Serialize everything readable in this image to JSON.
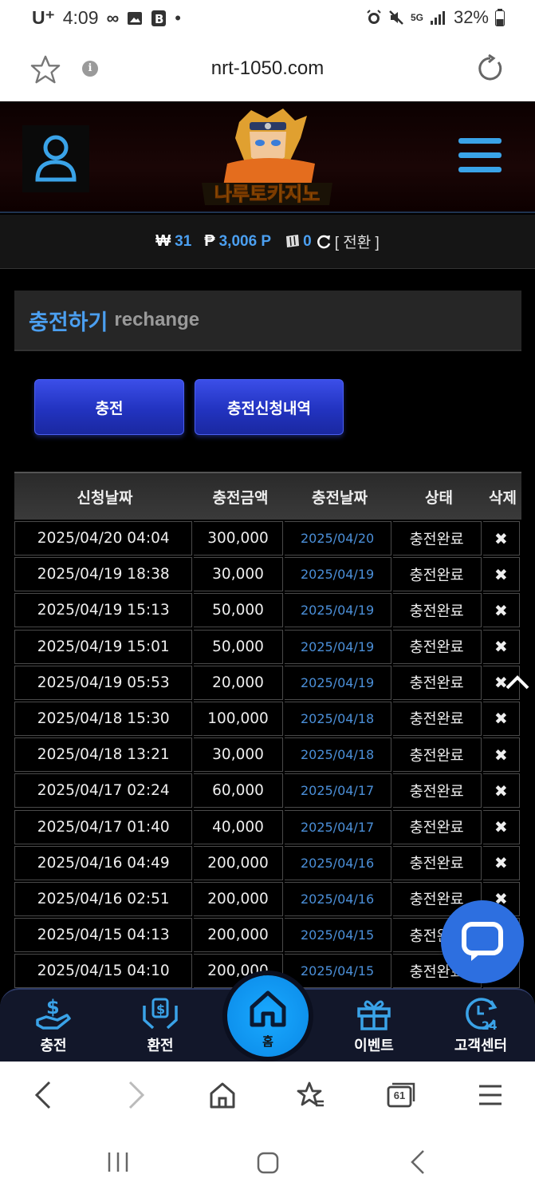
{
  "status_bar": {
    "carrier": "U⁺",
    "time": "4:09",
    "battery": "32%",
    "network": "5G"
  },
  "browser": {
    "url": "nrt-1050.com",
    "tabs_count": "61"
  },
  "site": {
    "logo_text": "나루토카지노"
  },
  "balance": {
    "won_symbol": "₩",
    "won_value": "31",
    "point_symbol": "₱",
    "point_value": "3,006 P",
    "chip_value": "0",
    "convert_label": "[ 전환 ]"
  },
  "page_title": {
    "ko": "충전하기",
    "en": "rechange"
  },
  "tabs": {
    "charge": "충전",
    "history": "충전신청내역"
  },
  "table": {
    "headers": [
      "신청날짜",
      "충전금액",
      "충전날짜",
      "상태",
      "삭제"
    ],
    "rows": [
      {
        "req": "2025/04/20 04:04",
        "amount": "300,000",
        "date": "2025/04/20",
        "status": "충전완료",
        "del": "✖"
      },
      {
        "req": "2025/04/19 18:38",
        "amount": "30,000",
        "date": "2025/04/19",
        "status": "충전완료",
        "del": "✖"
      },
      {
        "req": "2025/04/19 15:13",
        "amount": "50,000",
        "date": "2025/04/19",
        "status": "충전완료",
        "del": "✖"
      },
      {
        "req": "2025/04/19 15:01",
        "amount": "50,000",
        "date": "2025/04/19",
        "status": "충전완료",
        "del": "✖"
      },
      {
        "req": "2025/04/19 05:53",
        "amount": "20,000",
        "date": "2025/04/19",
        "status": "충전완료",
        "del": "✖"
      },
      {
        "req": "2025/04/18 15:30",
        "amount": "100,000",
        "date": "2025/04/18",
        "status": "충전완료",
        "del": "✖"
      },
      {
        "req": "2025/04/18 13:21",
        "amount": "30,000",
        "date": "2025/04/18",
        "status": "충전완료",
        "del": "✖"
      },
      {
        "req": "2025/04/17 02:24",
        "amount": "60,000",
        "date": "2025/04/17",
        "status": "충전완료",
        "del": "✖"
      },
      {
        "req": "2025/04/17 01:40",
        "amount": "40,000",
        "date": "2025/04/17",
        "status": "충전완료",
        "del": "✖"
      },
      {
        "req": "2025/04/16 04:49",
        "amount": "200,000",
        "date": "2025/04/16",
        "status": "충전완료",
        "del": "✖"
      },
      {
        "req": "2025/04/16 02:51",
        "amount": "200,000",
        "date": "2025/04/16",
        "status": "충전완료",
        "del": "✖"
      },
      {
        "req": "2025/04/15 04:13",
        "amount": "200,000",
        "date": "2025/04/15",
        "status": "충전완료",
        "del": "✖"
      },
      {
        "req": "2025/04/15 04:10",
        "amount": "200,000",
        "date": "2025/04/15",
        "status": "충전완료",
        "del": "✖"
      }
    ]
  },
  "bottom_nav": {
    "charge": "충전",
    "exchange": "환전",
    "home": "홈",
    "event": "이벤트",
    "support": "고객센터"
  },
  "colors": {
    "accent": "#4b9ff0",
    "button": "#2a3ad6",
    "home": "#129cf5"
  }
}
